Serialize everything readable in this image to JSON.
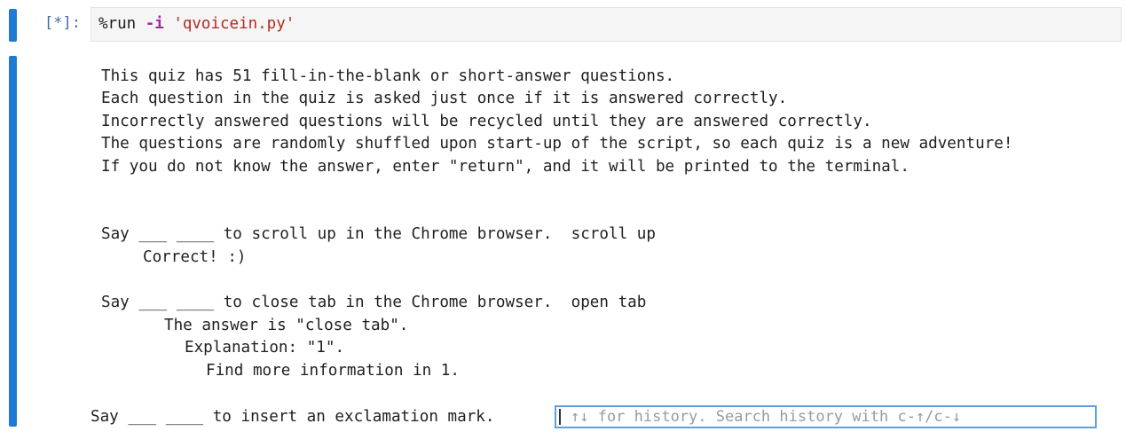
{
  "cell": {
    "prompt": "[*]:",
    "code": {
      "magic": "%run ",
      "flag": "-i",
      "space": " ",
      "filename": "'qvoicein.py'"
    }
  },
  "output": {
    "intro": [
      "This quiz has 51 fill-in-the-blank or short-answer questions.",
      "Each question in the quiz is asked just once if it is answered correctly.",
      "Incorrectly answered questions will be recycled until they are answered correctly.",
      "The questions are randomly shuffled upon start-up of the script, so each quiz is a new adventure!",
      "If you do not know the answer, enter \"return\", and it will be printed to the terminal."
    ],
    "q1": {
      "question": "Say ___ ____ to scroll up in the Chrome browser.  scroll up",
      "feedback": "Correct! :)"
    },
    "q2": {
      "question": "Say ___ ____ to close tab in the Chrome browser.  open tab",
      "answer": "The answer is \"close tab\".",
      "explanation": "Explanation: \"1\".",
      "more_info": "Find more information in 1."
    },
    "q3": {
      "question": "Say ___ ____ to insert an exclamation mark.",
      "input_value": "",
      "input_placeholder": "↑↓ for history. Search history with c-↑/c-↓"
    }
  },
  "colors": {
    "cell_bar": "#1f7bd1",
    "prompt": "#3b6fa8",
    "input_border": "#5f9fdc",
    "string": "#b22a22",
    "operator": "#a626a4"
  }
}
